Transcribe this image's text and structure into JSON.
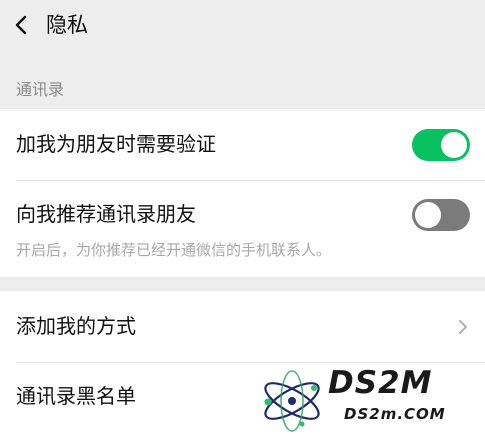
{
  "header": {
    "title": "隐私",
    "back_icon": "chevron-left-icon"
  },
  "contacts_section": {
    "label": "通讯录",
    "verify_friend": {
      "label": "加我为朋友时需要验证",
      "enabled": true
    },
    "recommend_contacts": {
      "label": "向我推荐通讯录朋友",
      "enabled": false,
      "description": "开启后，为你推荐已经开通微信的手机联系人。"
    }
  },
  "add_method": {
    "label": "添加我的方式",
    "icon": "chevron-right-icon"
  },
  "blacklist": {
    "label": "通讯录黑名单"
  },
  "watermark": {
    "brand": "DS2M",
    "domain": "DS2m.COM"
  },
  "colors": {
    "toggle_on": "#07c160",
    "toggle_off": "#7b7b7b",
    "background": "#ededed",
    "card": "#ffffff"
  }
}
